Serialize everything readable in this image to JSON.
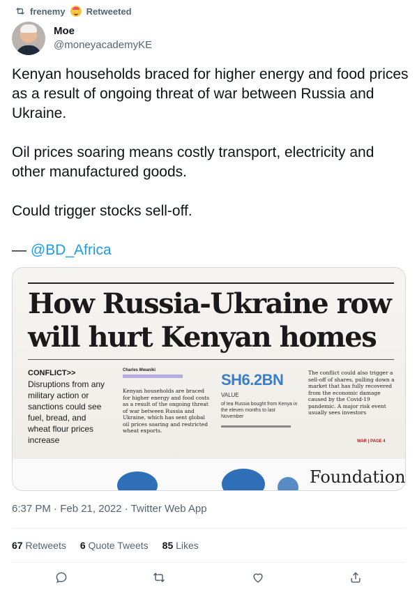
{
  "retweet": {
    "user": "frenemy",
    "label": "Retweeted"
  },
  "author": {
    "name": "Moe",
    "handle": "@moneyacademyKE"
  },
  "tweet": {
    "paragraphs": [
      "Kenyan households braced for higher energy and food prices as a result of ongoing threat of war between Russia and Ukraine.",
      "Oil prices soaring means costly transport, electricity and other manufactured goods.",
      "Could trigger stocks sell-off."
    ],
    "attribution_dash": "— ",
    "mention": "@BD_Africa"
  },
  "media": {
    "headline": "How Russia-Ukraine row will hurt Kenyan homes",
    "kicker": "CONFLICT>>",
    "dek": "Disruptions from any military action or sanctions could see fuel, bread, and wheat flour prices increase",
    "byline": "Charles Mwaniki",
    "body_col2": "Kenyan households are braced for higher energy and food costs as a result of the ongoing threat of war between Russia and Ukraine, which has sent global oil prices soaring and restricted wheat exports.",
    "stat_value": "SH6.2BN",
    "stat_label": "VALUE",
    "stat_desc": "of tea Russia bought from Kenya in the eleven months to last November",
    "body_col4": "The conflict could also trigger a sell-off of shares, pulling down a market that has fully recovered from the economic damage caused by the Covid-19 pandemic. A major risk event usually sees investors",
    "war_tag": "WAR | PAGE 4",
    "footer_word": "Foundation"
  },
  "timestamp": "6:37 PM · Feb 21, 2022 · Twitter Web App",
  "stats": {
    "retweets_count": "67",
    "retweets_label": "Retweets",
    "quotes_count": "6",
    "quotes_label": "Quote Tweets",
    "likes_count": "85",
    "likes_label": "Likes"
  },
  "icons": {
    "reply": "reply-icon",
    "retweet": "retweet-icon",
    "like": "heart-icon",
    "share": "share-icon"
  },
  "colors": {
    "link": "#1d9bf0",
    "secondary": "#536471",
    "stat_blue": "#3b7dc9"
  }
}
